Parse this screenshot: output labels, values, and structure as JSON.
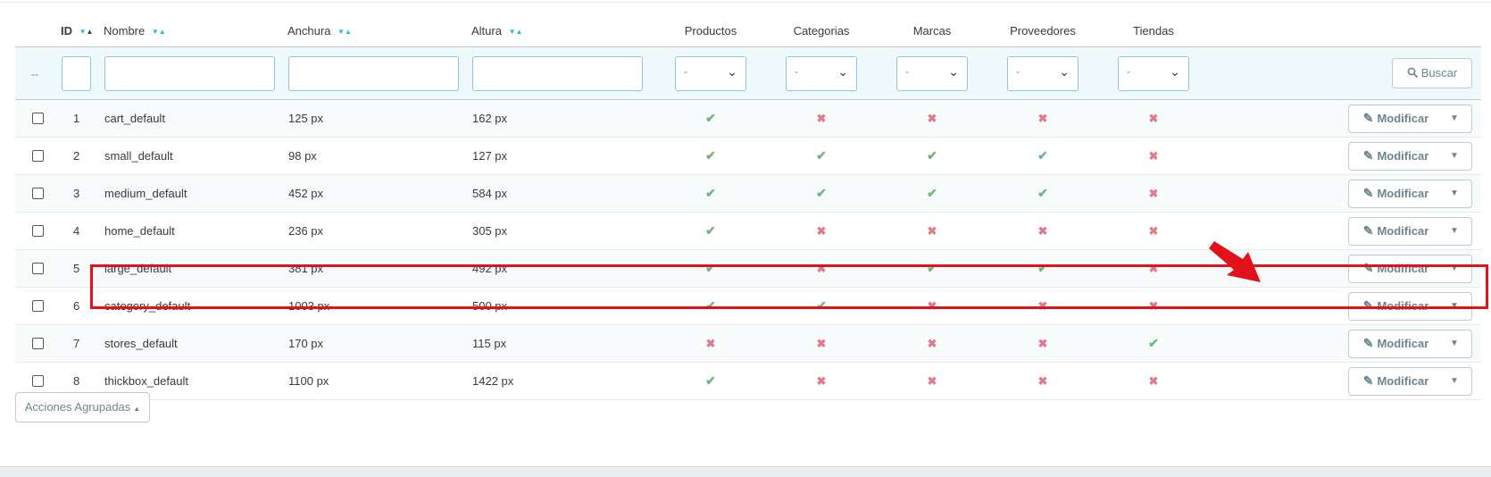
{
  "columns": {
    "id": "ID",
    "name": "Nombre",
    "width": "Anchura",
    "height": "Altura",
    "products": "Productos",
    "categories": "Categorias",
    "brands": "Marcas",
    "suppliers": "Proveedores",
    "stores": "Tiendas"
  },
  "filters": {
    "bulk_placeholder": "--",
    "select_value": "-",
    "search_label": "Buscar"
  },
  "rows": [
    {
      "id": "1",
      "name": "cart_default",
      "width": "125 px",
      "height": "162 px",
      "flags": [
        true,
        false,
        false,
        false,
        false
      ]
    },
    {
      "id": "2",
      "name": "small_default",
      "width": "98 px",
      "height": "127 px",
      "flags": [
        true,
        true,
        true,
        true,
        false
      ]
    },
    {
      "id": "3",
      "name": "medium_default",
      "width": "452 px",
      "height": "584 px",
      "flags": [
        true,
        true,
        true,
        true,
        false
      ]
    },
    {
      "id": "4",
      "name": "home_default",
      "width": "236 px",
      "height": "305 px",
      "flags": [
        true,
        false,
        false,
        false,
        false
      ]
    },
    {
      "id": "5",
      "name": "large_default",
      "width": "381 px",
      "height": "492 px",
      "flags": [
        true,
        false,
        true,
        true,
        false
      ]
    },
    {
      "id": "6",
      "name": "category_default",
      "width": "1003 px",
      "height": "500 px",
      "flags": [
        true,
        true,
        false,
        false,
        false
      ]
    },
    {
      "id": "7",
      "name": "stores_default",
      "width": "170 px",
      "height": "115 px",
      "flags": [
        false,
        false,
        false,
        false,
        true
      ]
    },
    {
      "id": "8",
      "name": "thickbox_default",
      "width": "1100 px",
      "height": "1422 px",
      "flags": [
        true,
        false,
        false,
        false,
        false
      ]
    }
  ],
  "row_action": {
    "label": "Modificar"
  },
  "bulk_actions": {
    "label": "Acciones Agrupadas"
  },
  "icons": {
    "check": "check-icon",
    "cross": "cross-icon",
    "search": "search-icon",
    "pencil": "pencil-icon",
    "caret": "caret-down-icon"
  },
  "colors": {
    "accent": "#25b9d7",
    "check": "#70b580",
    "cross": "#e07b8e",
    "highlight": "#e3121a"
  }
}
